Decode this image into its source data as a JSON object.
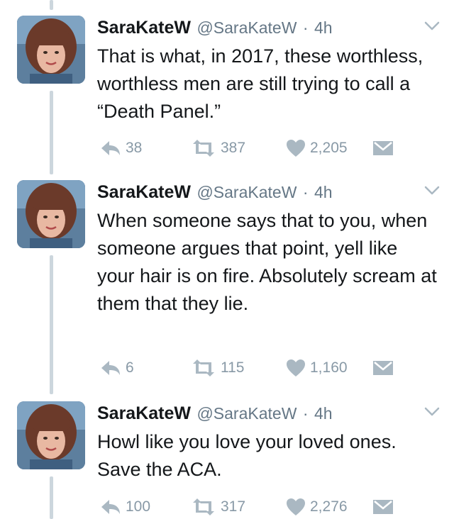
{
  "tweets": [
    {
      "name": "SaraKateW",
      "handle": "@SaraKateW",
      "separator": "·",
      "time": "4h",
      "text": "That is what, in 2017, these worthless, worthless men are still trying to call a “Death Panel.”",
      "replies": "38",
      "retweets": "387",
      "likes": "2,205"
    },
    {
      "name": "SaraKateW",
      "handle": "@SaraKateW",
      "separator": "·",
      "time": "4h",
      "text": "When someone says that to you, when someone argues that point, yell like your hair is on fire. Absolutely scream at them that they lie.",
      "replies": "6",
      "retweets": "115",
      "likes": "1,160"
    },
    {
      "name": "SaraKateW",
      "handle": "@SaraKateW",
      "separator": "·",
      "time": "4h",
      "text": "Howl like you love your loved ones. Save the ACA.",
      "replies": "100",
      "retweets": "317",
      "likes": "2,276"
    }
  ],
  "colors": {
    "text": "#14171a",
    "secondary": "#657786",
    "action": "#8899a6",
    "thread_line": "#ccd6dd"
  },
  "icons": {
    "reply": "reply-icon",
    "retweet": "retweet-icon",
    "like": "heart-icon",
    "dm": "envelope-icon",
    "more": "chevron-down-icon"
  }
}
